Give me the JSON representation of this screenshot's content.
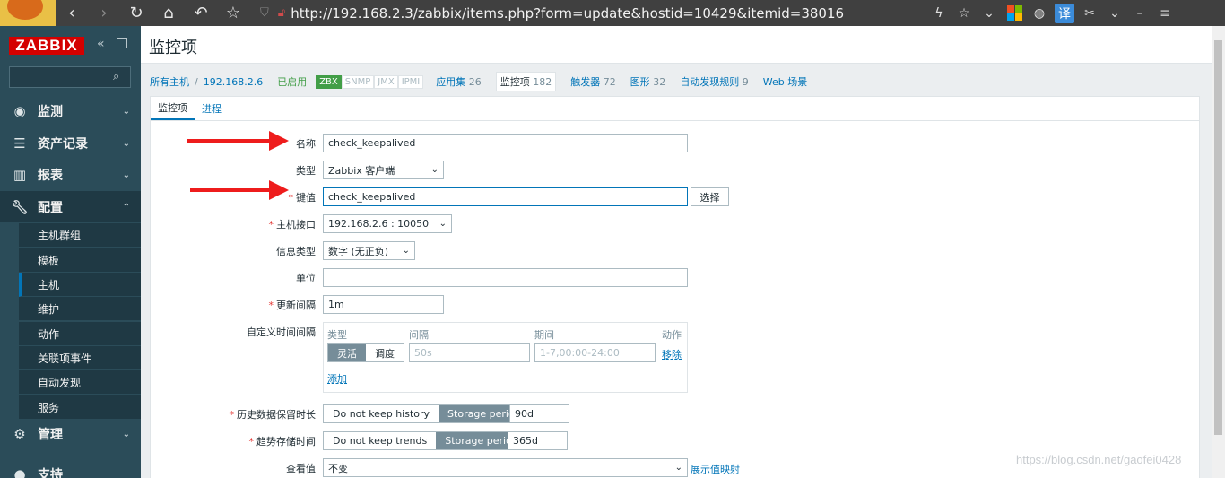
{
  "browser": {
    "url": "http://192.168.2.3/zabbix/items.php?form=update&hostid=10429&itemid=38016"
  },
  "sidebar": {
    "logo": "ZABBIX",
    "menu": [
      {
        "label": "监测",
        "icon": "eye-icon"
      },
      {
        "label": "资产记录",
        "icon": "list-icon"
      },
      {
        "label": "报表",
        "icon": "bar-chart-icon"
      },
      {
        "label": "配置",
        "icon": "wrench-icon"
      },
      {
        "label": "管理",
        "icon": "gear-icon"
      },
      {
        "label": "支持",
        "icon": "user-icon"
      }
    ],
    "submenu": [
      "主机群组",
      "模板",
      "主机",
      "维护",
      "动作",
      "关联项事件",
      "自动发现",
      "服务"
    ]
  },
  "page": {
    "title": "监控项"
  },
  "breadcrumbs": {
    "all_hosts": "所有主机",
    "separator": "/",
    "host": "192.168.2.6",
    "status": "已启用",
    "tags": [
      "ZBX",
      "SNMP",
      "JMX",
      "IPMI"
    ],
    "applications": "应用集",
    "applications_count": "26",
    "items": "监控项",
    "items_count": "182",
    "triggers": "触发器",
    "triggers_count": "72",
    "graphs": "图形",
    "graphs_count": "32",
    "discovery": "自动发现规则",
    "discovery_count": "9",
    "web": "Web 场景"
  },
  "tabs": [
    "监控项",
    "进程"
  ],
  "form": {
    "name_label": "名称",
    "name_value": "check_keepalived",
    "type_label": "类型",
    "type_value": "Zabbix 客户端",
    "key_label": "键值",
    "key_value": "check_keepalived",
    "select_button": "选择",
    "interface_label": "主机接口",
    "interface_value": "192.168.2.6 : 10050",
    "info_type_label": "信息类型",
    "info_type_value": "数字 (无正负)",
    "units_label": "单位",
    "units_value": "",
    "update_label": "更新间隔",
    "update_value": "1m",
    "custom_label": "自定义时间间隔",
    "custom_headers": [
      "类型",
      "间隔",
      "期间",
      "动作"
    ],
    "flexible": "灵活",
    "scheduling": "调度",
    "interval_placeholder": "50s",
    "period_placeholder": "1-7,00:00-24:00",
    "remove": "移除",
    "add": "添加",
    "history_label": "历史数据保留时长",
    "history_no_keep": "Do not keep history",
    "history_storage": "Storage period",
    "history_value": "90d",
    "trends_label": "趋势存储时间",
    "trends_no_keep": "Do not keep trends",
    "trends_storage": "Storage period",
    "trends_value": "365d",
    "valuemap_label": "查看值",
    "valuemap_value": "不变",
    "valuemap_link": "展示值映射"
  },
  "watermark": "https://blog.csdn.net/gaofei0428",
  "colors": {
    "sidebar": "#2b4c59",
    "accent": "#0275b8",
    "logo": "#d40000",
    "annotation_arrow": "#ee1c1c"
  }
}
